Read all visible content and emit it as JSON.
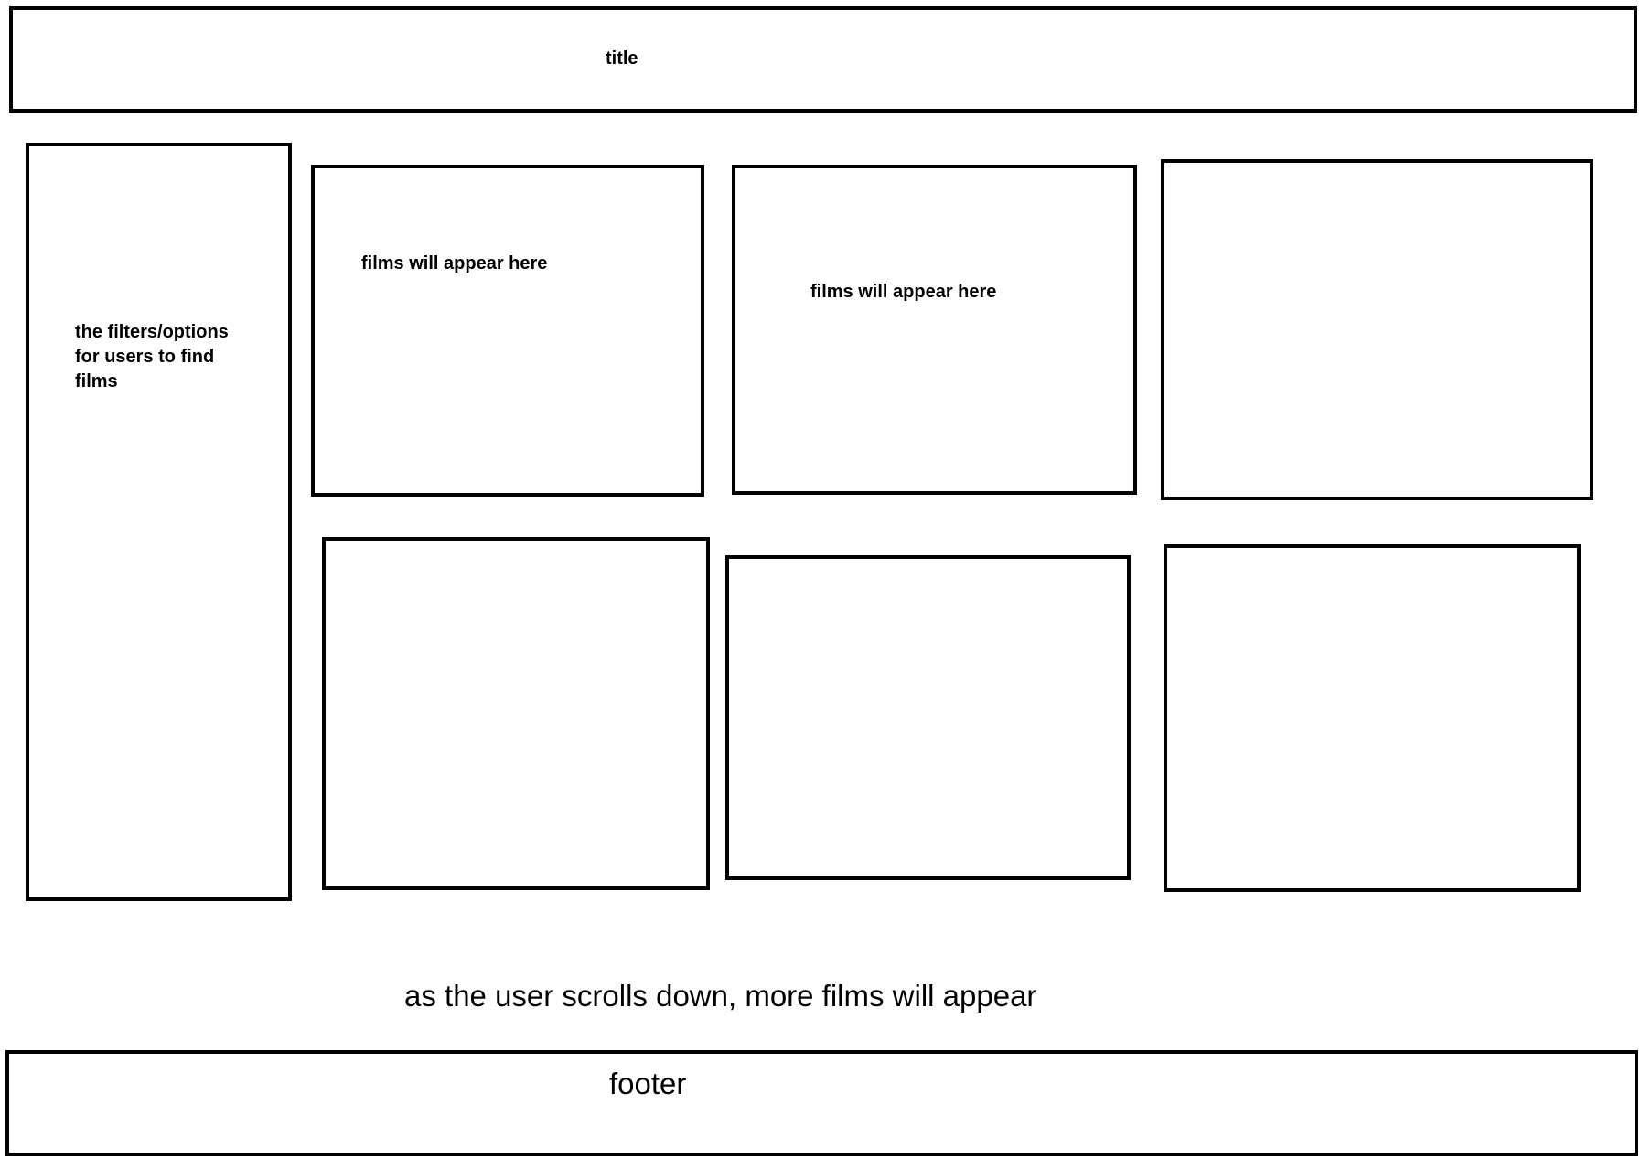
{
  "header": {
    "title_label": "title"
  },
  "sidebar": {
    "label": "the filters/options\nfor users to find\nfilms"
  },
  "film_cards": [
    {
      "label": "films will appear here"
    },
    {
      "label": "films will appear here"
    },
    {
      "label": ""
    },
    {
      "label": ""
    },
    {
      "label": ""
    },
    {
      "label": ""
    }
  ],
  "scroll_note": "as the user scrolls down, more films will appear",
  "footer": {
    "label": "footer"
  }
}
